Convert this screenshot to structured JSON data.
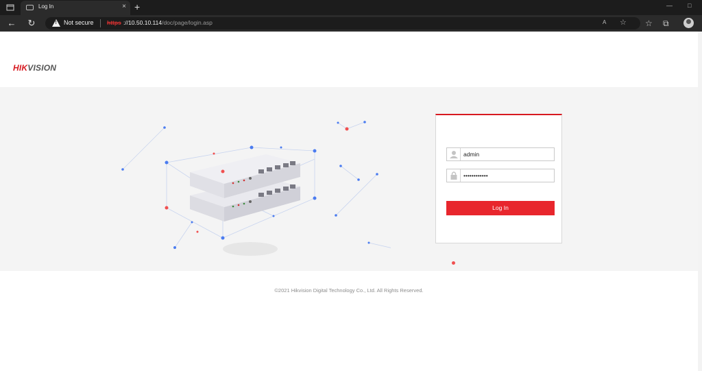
{
  "browser": {
    "tab_title": "Log In",
    "tab_close": "×",
    "new_tab": "+",
    "security_label": "Not secure",
    "url_scheme": "https",
    "url_host": "://10.50.10.114",
    "url_path": "/doc/page/login.asp",
    "read_aloud": "A",
    "window_minimize": "—",
    "window_maximize": "□"
  },
  "brand": {
    "logo_part1": "HIK",
    "logo_part2": "VISION",
    "accent_color": "#d71920"
  },
  "login": {
    "username_value": "admin",
    "password_value": "••••••••••••",
    "login_button_label": "Log In"
  },
  "footer": {
    "copyright": "©2021 Hikvision Digital Technology Co., Ltd. All Rights Reserved."
  }
}
